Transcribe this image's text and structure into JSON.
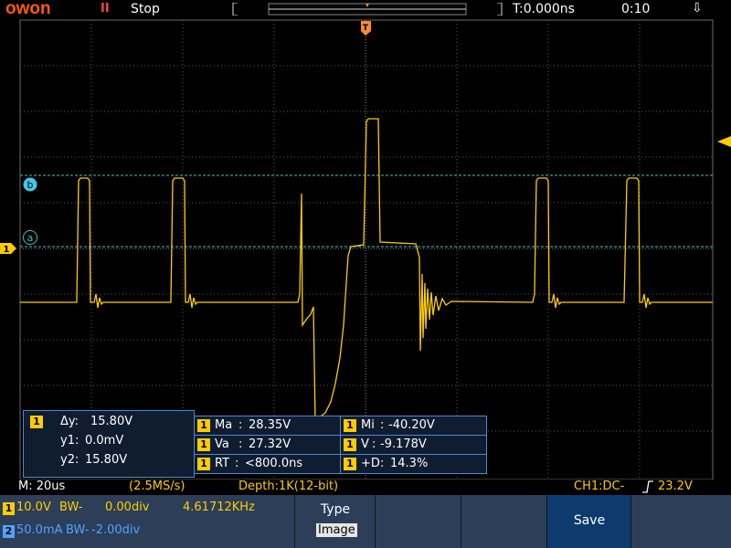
{
  "header": {
    "logo": "owon",
    "run_icon": "pause-icon",
    "run_glyph": "II",
    "status": "Stop",
    "trigger_time": "T:0.000ns",
    "clock": "0:10",
    "usb_icon": "usb-icon",
    "usb_glyph": "⇩"
  },
  "markers": {
    "trigger_marker": "T",
    "ch1_marker": "1",
    "cursor_a": "a",
    "cursor_b": "b"
  },
  "colors": {
    "ch1": "#ffcc00",
    "ch2": "#4fa3ff",
    "grid": "#5a5a5a",
    "cursor": "#3fbfbf",
    "panel": "#2c3e58",
    "save_key": "#0f3a6e"
  },
  "cursor_measure": {
    "channel": "1",
    "delta_label": "Δy:",
    "delta_value": "15.80V",
    "y1_label": "y1:",
    "y1_value": "0.0mV",
    "y2_label": "y2:",
    "y2_value": "15.80V"
  },
  "measurements": [
    {
      "channel": "1",
      "label": "Ma",
      "value": "28.35V"
    },
    {
      "channel": "1",
      "label": "Mi",
      "value": "-40.20V"
    },
    {
      "channel": "1",
      "label": "Va",
      "value": "27.32V"
    },
    {
      "channel": "1",
      "label": "V",
      "value": "-9.178V"
    },
    {
      "channel": "1",
      "label": "RT",
      "value": "<800.0ns"
    },
    {
      "channel": "1",
      "label": "+D",
      "value": "14.3%"
    }
  ],
  "status_line": {
    "timebase": "M: 20us",
    "sample_rate": "(2.5MS/s)",
    "depth": "Depth:1K(12-bit)",
    "trigger": "CH1:DC-",
    "trigger_edge_icon": "rising-edge-icon",
    "trigger_level": "23.2V"
  },
  "channels": [
    {
      "id": "1",
      "volts": "10.0V",
      "bw": "BW-",
      "offset": "0.00div",
      "freq": "4.61712KHz"
    },
    {
      "id": "2",
      "volts": "50.0mA",
      "bw": "BW-",
      "offset": "-2.00div"
    }
  ],
  "softkeys": {
    "type_title": "Type",
    "type_value": "Image",
    "save": "Save"
  }
}
